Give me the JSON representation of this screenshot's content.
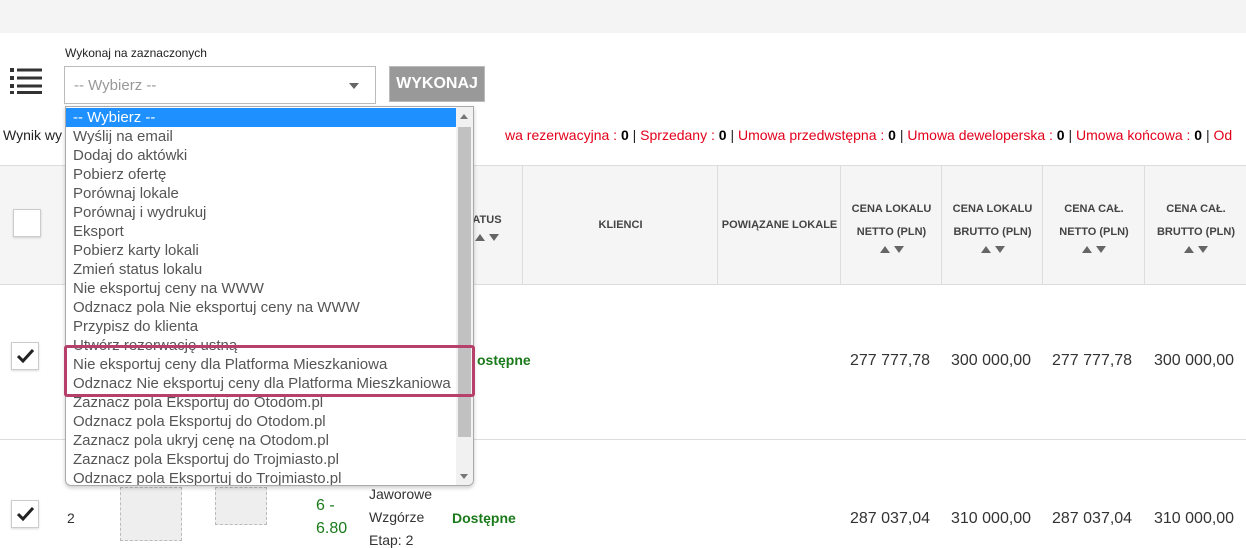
{
  "bulk_action": {
    "label": "Wykonaj na zaznaczonych",
    "select_value": "-- Wybierz --",
    "button": "WYKONAJ",
    "options": [
      "-- Wybierz --",
      "Wyślij na email",
      "Dodaj do aktówki",
      "Pobierz ofertę",
      "Porównaj lokale",
      "Porównaj i wydrukuj",
      "Eksport",
      "Pobierz karty lokali",
      "Zmień status lokalu",
      "Nie eksportuj ceny na WWW",
      "Odznacz pola Nie eksportuj ceny na WWW",
      "Przypisz do klienta",
      "Utwórz rezerwację ustną",
      "Nie eksportuj ceny dla Platforma Mieszkaniowa",
      "Odznacz Nie eksportuj ceny dla Platforma Mieszkaniowa",
      "Zaznacz pola Eksportuj do Otodom.pl",
      "Odznacz pola Eksportuj do Otodom.pl",
      "Zaznacz pola ukryj cenę na Otodom.pl",
      "Zaznacz pola Eksportuj do Trojmiasto.pl",
      "Odznacz pola Eksportuj do Trojmiasto.pl"
    ]
  },
  "summary": {
    "prefix": "Wynik wy",
    "items": [
      {
        "label": "wa rezerwacyjna : ",
        "count": "0"
      },
      {
        "label": "Sprzedany : ",
        "count": "0"
      },
      {
        "label": "Umowa przedwstępna : ",
        "count": "0"
      },
      {
        "label": "Umowa deweloperska : ",
        "count": "0"
      },
      {
        "label": "Umowa końcowa : ",
        "count": "0"
      },
      {
        "label": "Od",
        "count": ""
      }
    ]
  },
  "table": {
    "headers": {
      "status": "ATUS",
      "clients": "KLIENCI",
      "related": "POWIĄZANE LOKALE",
      "net_price_l1": "CENA LOKALU",
      "net_price_l2": "NETTO (PLN)",
      "gross_price_l1": "CENA LOKALU",
      "gross_price_l2": "BRUTTO (PLN)",
      "total_net_l1": "CENA CAŁ.",
      "total_net_l2": "NETTO (PLN)",
      "total_gross_l1": "CENA CAŁ.",
      "total_gross_l2": "BRUTTO (PLN)"
    },
    "rows": [
      {
        "status": "ostępne",
        "net": "277 777,78",
        "gross": "300 000,00",
        "total_net": "277 777,78",
        "total_gross": "300 000,00",
        "checked": true
      },
      {
        "num": "2",
        "floor_a": "6 -",
        "floor_b": "6.80",
        "inv_a": "Jaworowe",
        "inv_b": "Wzgórze",
        "inv_c": "Etap: 2",
        "status": "Dostępne",
        "net": "287 037,04",
        "gross": "310 000,00",
        "total_net": "287 037,04",
        "total_gross": "310 000,00",
        "checked": true
      }
    ]
  }
}
